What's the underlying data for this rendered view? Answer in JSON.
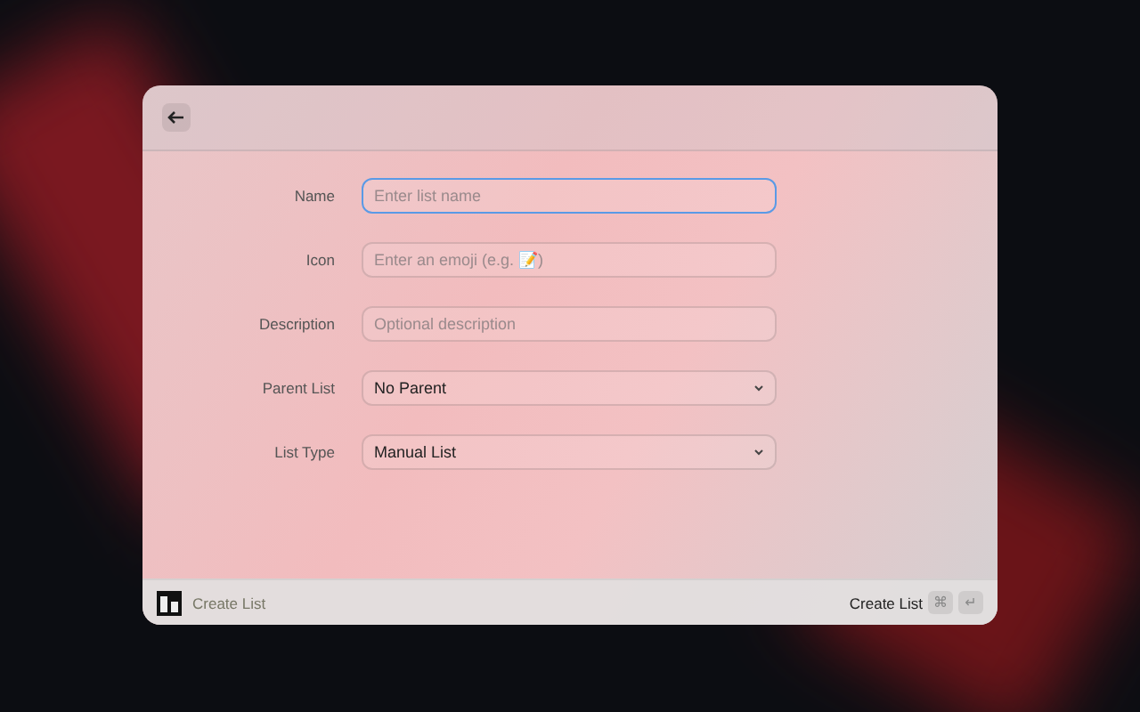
{
  "fields": [
    {
      "label": "Name",
      "kind": "text",
      "placeholder": "Enter list name",
      "focused": true
    },
    {
      "label": "Icon",
      "kind": "text",
      "placeholder": "Enter an emoji (e.g. 📝)",
      "focused": false
    },
    {
      "label": "Description",
      "kind": "text",
      "placeholder": "Optional description",
      "focused": false
    },
    {
      "label": "Parent List",
      "kind": "select",
      "value": "No Parent",
      "focused": false
    },
    {
      "label": "List Type",
      "kind": "select",
      "value": "Manual List",
      "focused": false
    }
  ],
  "footer": {
    "title": "Create List",
    "action": "Create List",
    "keys": [
      "⌘",
      "↵"
    ]
  }
}
